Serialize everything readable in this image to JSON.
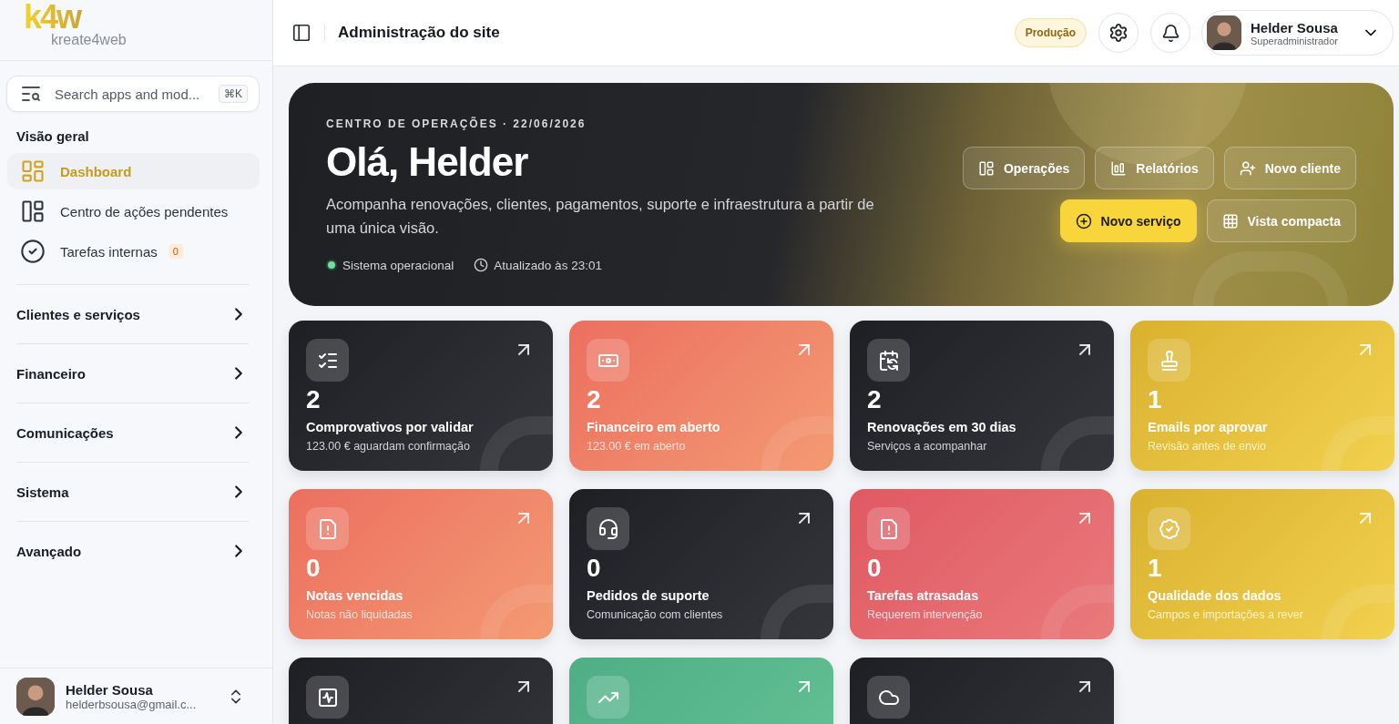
{
  "logo": {
    "mark": "k4w",
    "name": "kreate4web"
  },
  "search": {
    "placeholder": "Search apps and mod...",
    "shortcut": "⌘K"
  },
  "sidebar": {
    "section_title": "Visão geral",
    "items": [
      {
        "label": "Dashboard",
        "selected": true
      },
      {
        "label": "Centro de ações pendentes",
        "selected": false
      },
      {
        "label": "Tarefas internas",
        "selected": false,
        "badge": "0"
      }
    ],
    "groups": [
      {
        "label": "Clientes e serviços",
        "expanded": false
      },
      {
        "label": "Financeiro",
        "expanded": false
      },
      {
        "label": "Comunicações",
        "expanded": false
      },
      {
        "label": "Sistema",
        "expanded": false
      },
      {
        "label": "Avançado",
        "expanded": false
      }
    ],
    "user": {
      "name": "Helder Sousa",
      "email": "helderbsousa@gmail.c..."
    }
  },
  "header": {
    "title": "Administração do site",
    "environment": "Produção",
    "user": {
      "name": "Helder Sousa",
      "role": "Superadministrador"
    }
  },
  "hero": {
    "eyebrow": "CENTRO DE OPERAÇÕES · 22/06/2026",
    "title": "Olá, Helder",
    "description": "Acompanha renovações, clientes, pagamentos, suporte e infraestrutura a partir de uma única visão.",
    "status": "Sistema operacional",
    "updated": "Atualizado às 23:01",
    "actions": [
      {
        "label": "Operações",
        "kind": "ghost"
      },
      {
        "label": "Relatórios",
        "kind": "ghost"
      },
      {
        "label": "Novo cliente",
        "kind": "ghost"
      },
      {
        "label": "Novo serviço",
        "kind": "primary"
      },
      {
        "label": "Vista compacta",
        "kind": "ghost"
      }
    ]
  },
  "cards": [
    {
      "kind": "dark",
      "value": "2",
      "title": "Comprovativos por validar",
      "subtitle": "123.00 € aguardam confirmação"
    },
    {
      "kind": "coral",
      "value": "2",
      "title": "Financeiro em aberto",
      "subtitle": "123.00 € em aberto"
    },
    {
      "kind": "dark",
      "value": "2",
      "title": "Renovações em 30 dias",
      "subtitle": "Serviços a acompanhar"
    },
    {
      "kind": "yellow",
      "value": "1",
      "title": "Emails por aprovar",
      "subtitle": "Revisão antes de envio"
    },
    {
      "kind": "coral",
      "value": "0",
      "title": "Notas vencidas",
      "subtitle": "Notas não liquidadas"
    },
    {
      "kind": "dark",
      "value": "0",
      "title": "Pedidos de suporte",
      "subtitle": "Comunicação com clientes"
    },
    {
      "kind": "red",
      "value": "0",
      "title": "Tarefas atrasadas",
      "subtitle": "Requerem intervenção"
    },
    {
      "kind": "yellow",
      "value": "1",
      "title": "Qualidade dos dados",
      "subtitle": "Campos e importações a rever"
    },
    {
      "kind": "dark"
    },
    {
      "kind": "green"
    },
    {
      "kind": "dark"
    }
  ]
}
